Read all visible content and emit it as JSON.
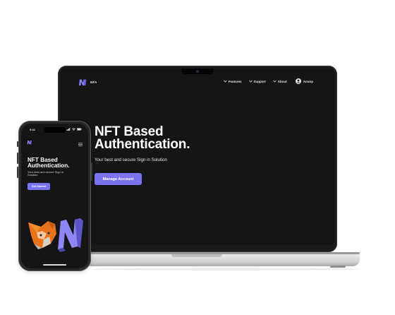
{
  "laptop": {
    "nav": {
      "logo_text": "NFA",
      "menu": [
        {
          "label": "Features"
        },
        {
          "label": "Support"
        },
        {
          "label": "About"
        }
      ],
      "user_label": "Anoop"
    },
    "hero": {
      "title_line1": "NFT Based",
      "title_line2": "Authentication.",
      "subtitle": "Your best and secure Sign in Solution",
      "button_label": "Manage Account"
    }
  },
  "phone": {
    "status_time": "9:41",
    "hero": {
      "title_line1": "NFT Based",
      "title_line2": "Authentication.",
      "subtitle": "Your best and secure Sign in Solution",
      "button_label": "Get Started"
    }
  },
  "colors": {
    "accent": "#7b72f0",
    "screen_bg": "#151515",
    "text": "#ffffff"
  },
  "icons": [
    "nfa-logo-icon",
    "chevron-down-icon",
    "user-icon",
    "menu-icon",
    "signal-icon",
    "wifi-icon",
    "battery-icon",
    "fox-icon"
  ]
}
